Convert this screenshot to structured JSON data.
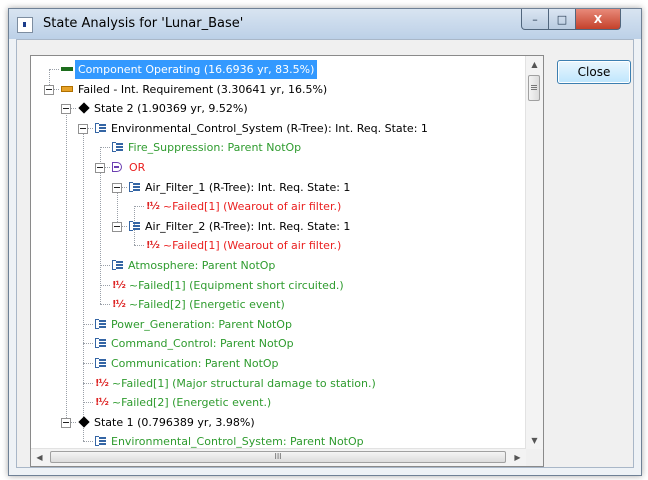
{
  "window": {
    "title": "State Analysis for 'Lunar_Base'",
    "controls": {
      "minimize": "–",
      "maximize": "□",
      "close": "X"
    }
  },
  "close_button": {
    "label": "Close"
  },
  "tree": {
    "rows": [
      {
        "text": "Component Operating (16.6936 yr, 83.5%)",
        "icon": "green-bar-icon",
        "style": "sel"
      },
      {
        "text": "Failed - Int. Requirement (3.30641 yr, 16.5%)",
        "icon": "orange-bar-icon",
        "style": ""
      },
      {
        "text": "State 2 (1.90369 yr, 9.52%)",
        "icon": "diamond-state-icon",
        "style": ""
      },
      {
        "text": "Environmental_Control_System (R-Tree): Int. Req. State: 1",
        "icon": "rtree-icon",
        "style": ""
      },
      {
        "text": "Fire_Suppression: Parent NotOp",
        "icon": "rtree-icon",
        "style": "green"
      },
      {
        "text": "OR",
        "icon": "or-gate-icon",
        "style": "red"
      },
      {
        "text": "Air_Filter_1 (R-Tree): Int. Req. State: 1",
        "icon": "rtree-icon",
        "style": ""
      },
      {
        "text": "~Failed[1]  (Wearout of air filter.)",
        "icon": "failure-icon",
        "style": "red"
      },
      {
        "text": "Air_Filter_2 (R-Tree): Int. Req. State: 1",
        "icon": "rtree-icon",
        "style": ""
      },
      {
        "text": "~Failed[1]  (Wearout of air filter.)",
        "icon": "failure-icon",
        "style": "red"
      },
      {
        "text": "Atmosphere: Parent NotOp",
        "icon": "rtree-icon",
        "style": "green"
      },
      {
        "text": "~Failed[1]  (Equipment short circuited.)",
        "icon": "failure-icon",
        "style": "green"
      },
      {
        "text": "~Failed[2]  (Energetic event)",
        "icon": "failure-icon",
        "style": "green"
      },
      {
        "text": "Power_Generation: Parent NotOp",
        "icon": "rtree-icon",
        "style": "green"
      },
      {
        "text": "Command_Control: Parent NotOp",
        "icon": "rtree-icon",
        "style": "green"
      },
      {
        "text": "Communication: Parent NotOp",
        "icon": "rtree-icon",
        "style": "green"
      },
      {
        "text": "~Failed[1]  (Major structural damage to station.)",
        "icon": "failure-icon",
        "style": "green"
      },
      {
        "text": "~Failed[2]  (Energetic event.)",
        "icon": "failure-icon",
        "style": "green"
      },
      {
        "text": "State 1 (0.796389 yr, 3.98%)",
        "icon": "diamond-state-icon",
        "style": ""
      },
      {
        "text": "Environmental_Control_System: Parent NotOp",
        "icon": "rtree-icon",
        "style": "green"
      }
    ]
  },
  "failure_glyph": "!½",
  "scroll": {
    "up": "▲",
    "down": "▼",
    "left": "◀",
    "right": "▶",
    "grip": "III"
  }
}
